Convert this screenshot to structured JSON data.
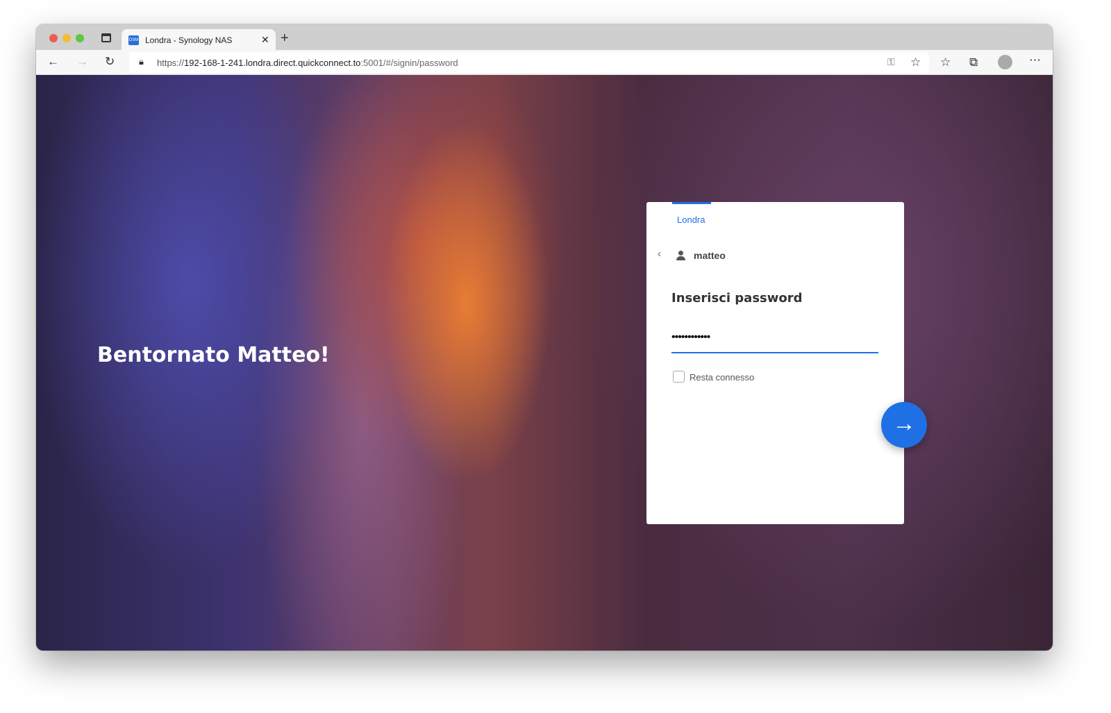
{
  "browser": {
    "tab_title": "Londra - Synology NAS",
    "favicon_text": "DSM",
    "url_prefix": "https://",
    "url_host": "192-168-1-241.londra.direct.quickconnect.to",
    "url_rest": ":5001/#/signin/password"
  },
  "page": {
    "welcome": "Bentornato Matteo!",
    "server_tab": "Londra",
    "username": "matteo",
    "heading": "Inserisci password",
    "password_value": "••••••••••••",
    "remember_label": "Resta connesso"
  },
  "colors": {
    "accent": "#1f70e5"
  }
}
